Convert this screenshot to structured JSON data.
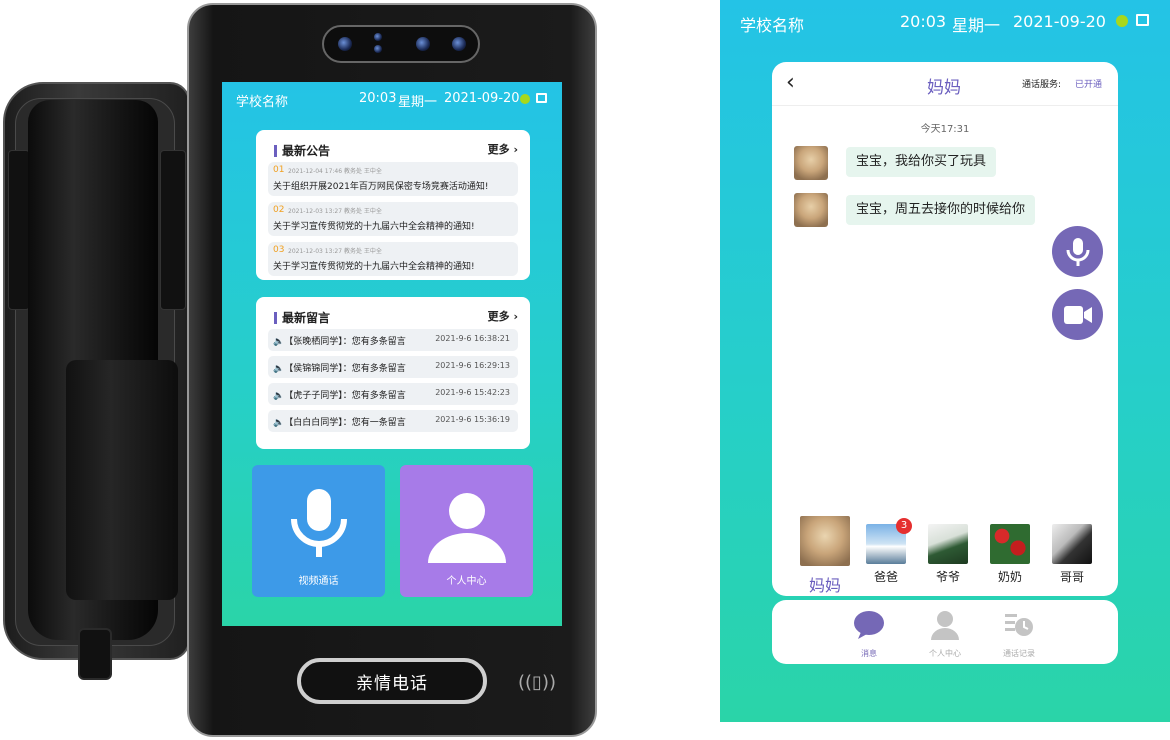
{
  "device": {
    "status_bar": {
      "school": "学校名称",
      "time": "20:03",
      "weekday": "星期一",
      "date": "2021-09-20"
    },
    "announcements": {
      "title": "最新公告",
      "more": "更多",
      "items": [
        {
          "num": "01",
          "meta": "2021-12-04  17:46  教务处  王中全",
          "text": "关于组织开展2021年百万网民保密专场竞赛活动通知!"
        },
        {
          "num": "02",
          "meta": "2021-12-03  13:27  教务处  王中全",
          "text": "关于学习宣传贯彻党的十九届六中全会精神的通知!"
        },
        {
          "num": "03",
          "meta": "2021-12-03  13:27  教务处  王中全",
          "text": "关于学习宣传贯彻党的十九届六中全会精神的通知!"
        }
      ]
    },
    "messages": {
      "title": "最新留言",
      "more": "更多",
      "items": [
        {
          "who": "【张晚栖同学】：您有多条留言",
          "time": "2021-9-6  16:38:21"
        },
        {
          "who": "【侯锦锦同学】：您有多条留言",
          "time": "2021-9-6  16:29:13"
        },
        {
          "who": "【虎子子同学】：您有多条留言",
          "time": "2021-9-6  15:42:23"
        },
        {
          "who": "【白白白同学】：您有一条留言",
          "time": "2021-9-6  15:36:19"
        }
      ]
    },
    "tiles": {
      "video_call": "视频通话",
      "personal_center": "个人中心"
    },
    "call_button": "亲情电话",
    "colors": {
      "accent_purple": "#7568b6",
      "video_tile": "#3d9ae8",
      "personal_tile": "#a77be8",
      "status_dot": "#a8d81c"
    }
  },
  "app": {
    "status_bar": {
      "school": "学校名称",
      "time": "20:03",
      "weekday": "星期一",
      "date": "2021-09-20"
    },
    "chat": {
      "contact_name": "妈妈",
      "service_label": "通话服务:",
      "service_status": "已开通",
      "timestamp": "今天17:31",
      "messages": [
        "宝宝，我给你买了玩具",
        "宝宝，周五去接你的时候给你"
      ]
    },
    "contacts": [
      {
        "name": "妈妈",
        "badge": null,
        "active": true
      },
      {
        "name": "爸爸",
        "badge": "3",
        "active": false
      },
      {
        "name": "爷爷",
        "badge": null,
        "active": false
      },
      {
        "name": "奶奶",
        "badge": null,
        "active": false
      },
      {
        "name": "哥哥",
        "badge": null,
        "active": false
      }
    ],
    "nav": [
      {
        "label": "消息",
        "icon": "chat-bubble-icon",
        "active": true
      },
      {
        "label": "个人中心",
        "icon": "person-icon",
        "active": false
      },
      {
        "label": "通话记录",
        "icon": "call-log-icon",
        "active": false
      }
    ]
  }
}
